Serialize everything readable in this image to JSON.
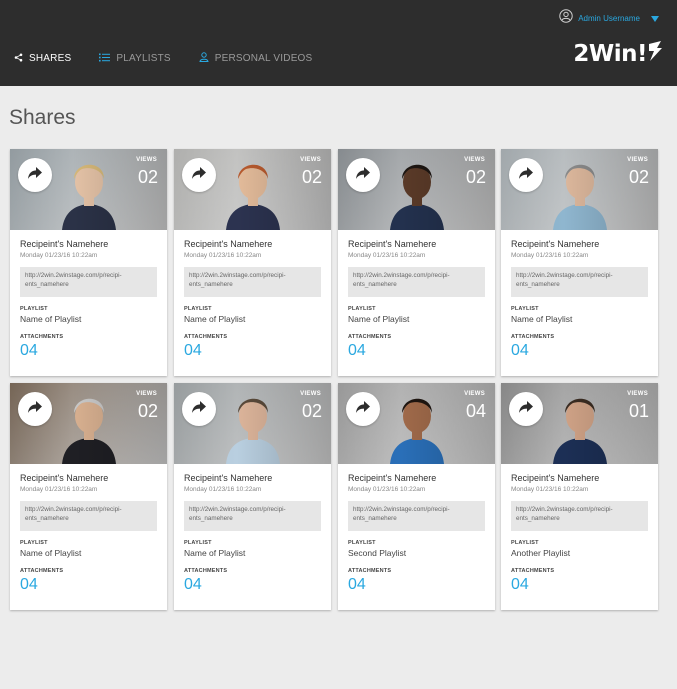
{
  "header": {
    "user_name": "Admin Username",
    "logo_text": "2Win!",
    "colors": {
      "bar": "#2d2d2d",
      "accent": "#2aa8e0"
    }
  },
  "nav": {
    "items": [
      {
        "label": "SHARES",
        "icon": "share-icon",
        "active": true
      },
      {
        "label": "PLAYLISTS",
        "icon": "list-icon",
        "active": false
      },
      {
        "label": "PERSONAL VIDEOS",
        "icon": "person-icon",
        "active": false
      }
    ]
  },
  "page": {
    "title": "Shares"
  },
  "labels": {
    "views": "VIEWS",
    "playlist": "PLAYLIST",
    "attachments": "ATTACHMENTS"
  },
  "cards": [
    {
      "views": "02",
      "recipient": "Recipeint's Namehere",
      "date": "Monday 01/23/16 10:22am",
      "link": "http://2win.2winstage.com/p/recipi-ents_namehere",
      "playlist": "Name of Playlist",
      "attachments": "04",
      "bg": "#9aa3a8",
      "skin": "#e4c2a6",
      "hair": "#d6b878",
      "suit": "#2b3247"
    },
    {
      "views": "02",
      "recipient": "Recipeint's Namehere",
      "date": "Monday 01/23/16 10:22am",
      "link": "http://2win.2winstage.com/p/recipi-ents_namehere",
      "playlist": "Name of Playlist",
      "attachments": "04",
      "bg": "#b8b8b6",
      "skin": "#e3bb9a",
      "hair": "#b85a2e",
      "suit": "#2c3350"
    },
    {
      "views": "02",
      "recipient": "Recipeint's Namehere",
      "date": "Monday 01/23/16 10:22am",
      "link": "http://2win.2winstage.com/p/recipi-ents_namehere",
      "playlist": "Name of Playlist",
      "attachments": "04",
      "bg": "#8d9296",
      "skin": "#5a3a28",
      "hair": "#1d1612",
      "suit": "#23314e"
    },
    {
      "views": "02",
      "recipient": "Recipeint's Namehere",
      "date": "Monday 01/23/16 10:22am",
      "link": "http://2win.2winstage.com/p/recipi-ents_namehere",
      "playlist": "Name of Playlist",
      "attachments": "04",
      "bg": "#a9b0b4",
      "skin": "#dcb79c",
      "hair": "#8a8a8a",
      "suit": "#8fb6cf"
    },
    {
      "views": "02",
      "recipient": "Recipeint's Namehere",
      "date": "Monday 01/23/16 10:22am",
      "link": "http://2win.2winstage.com/p/recipi-ents_namehere",
      "playlist": "Name of Playlist",
      "attachments": "04",
      "bg": "#7b6a5a",
      "skin": "#d8b090",
      "hair": "#c9c9c9",
      "suit": "#1f1f24"
    },
    {
      "views": "02",
      "recipient": "Recipeint's Namehere",
      "date": "Monday 01/23/16 10:22am",
      "link": "http://2win.2winstage.com/p/recipi-ents_namehere",
      "playlist": "Name of Playlist",
      "attachments": "04",
      "bg": "#9fa4a6",
      "skin": "#dcb49a",
      "hair": "#5a4a3a",
      "suit": "#b9cfe0"
    },
    {
      "views": "04",
      "recipient": "Recipeint's Namehere",
      "date": "Monday 01/23/16 10:22am",
      "link": "http://2win.2winstage.com/p/recipi-ents_namehere",
      "playlist": "Second Playlist",
      "attachments": "04",
      "bg": "#a0a0a0",
      "skin": "#a06a4a",
      "hair": "#1e1510",
      "suit": "#2a6fb8"
    },
    {
      "views": "01",
      "recipient": "Recipeint's Namehere",
      "date": "Monday 01/23/16 10:22am",
      "link": "http://2win.2winstage.com/p/recipi-ents_namehere",
      "playlist": "Another Playlist",
      "attachments": "04",
      "bg": "#8e8e8e",
      "skin": "#cfa286",
      "hair": "#3a2c22",
      "suit": "#1c2f55"
    }
  ]
}
